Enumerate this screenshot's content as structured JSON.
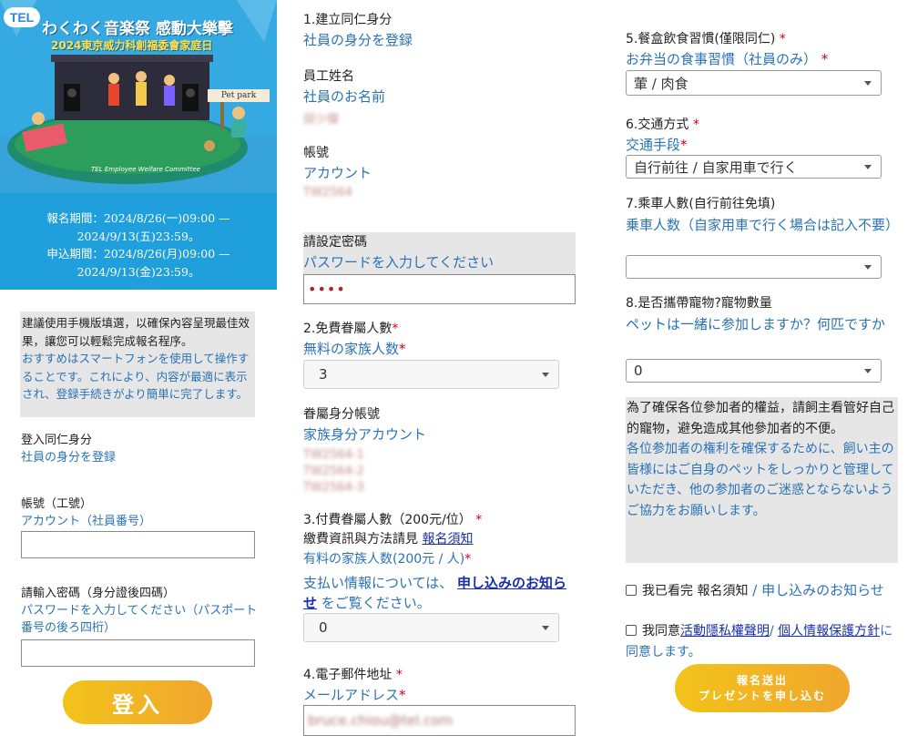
{
  "left": {
    "banner": {
      "logo": "TEL",
      "title_line1": "わくわく音楽祭 感動大樂擊",
      "title_line2": "2024東京威力科創福委會家庭日",
      "sign": "Pet park",
      "committee": "TEL Employee Welfare Committee"
    },
    "period": {
      "line1": "報名期間：2024/8/26(一)09:00 —",
      "line2": "2024/9/13(五)23:59。",
      "line3": "申込期間：2024/8/26(月)09:00 —",
      "line4": "2024/9/13(金)23:59。"
    },
    "notice": {
      "zh": "建議使用手機版填選，以確保內容呈現最佳效果，讓您可以輕鬆完成報名程序。",
      "jp": "おすすめはスマートフォンを使用して操作することです。これにより、内容が最適に表示され、登録手続きがより簡単に完了します。"
    },
    "login": {
      "heading_zh": "登入同仁身分",
      "heading_jp": "社員の身分を登録",
      "account_zh": "帳號（工號）",
      "account_jp": "アカウント（社員番号）",
      "password_zh": "請輸入密碼（身分證後四碼）",
      "password_jp": "パスワードを入力してください（パスポート番号の後ろ四桁）",
      "button": "登入"
    }
  },
  "mid": {
    "s1_zh": "1.建立同仁身分",
    "s1_jp": "社員の身分を登録",
    "name_zh": "員工姓名",
    "name_jp": "社員のお名前",
    "name_value": "邱少傑",
    "acct_zh": "帳號",
    "acct_jp": "アカウント",
    "acct_value": "TW2564",
    "pwd_zh": "請設定密碼",
    "pwd_jp": "パスワードを入力してください",
    "pwd_value": "••••",
    "s2_zh": "2.免費眷屬人數",
    "s2_jp": "無料の家族人数",
    "s2_value": "3",
    "fam_zh": "眷屬身分帳號",
    "fam_jp": "家族身分アカウント",
    "fam_values": [
      "TW2564-1",
      "TW2564-2",
      "TW2564-3"
    ],
    "s3_zh": "3.付費眷屬人數（200元/位）",
    "s3_note_zh": "繳費資訊與方法請見",
    "s3_note_link": "報名須知",
    "s3_jp": "有料の家族人数(200元 / 人)",
    "s3_note_jp_pre": "支払い情報については、",
    "s3_note_jp_link": "申し込みのお知らせ",
    "s3_note_jp_post": "をご覧ください。",
    "s3_value": "0",
    "s4_zh": "4.電子郵件地址",
    "s4_jp": "メールアドレス",
    "s4_value": "bruce.chiou@tel.com",
    "star": "*"
  },
  "right": {
    "s5_zh": "5.餐盒飲食習慣(僅限同仁)",
    "s5_jp": "お弁当の食事習慣（社員のみ）",
    "s5_value": "葷 / 肉食",
    "s6_zh": "6.交通方式",
    "s6_jp": "交通手段",
    "s6_value": "自行前往 / 自家用車で行く",
    "s7_zh": "7.乘車人數(自行前往免填)",
    "s7_jp": "乗車人数（自家用車で行く場合は記入不要）",
    "s7_value": "",
    "s8_zh": "8.是否攜帶寵物?寵物數量",
    "s8_jp": "ペットは一緒に参加しますか？何匹ですか",
    "s8_value": "0",
    "pet_notice_zh": "為了確保各位參加者的權益，請飼主看管好自己的寵物，避免造成其他參加者的不便。",
    "pet_notice_jp": "各位参加者の権利を確保するために、飼い主の皆様にはご自身のペットをしっかりと管理していただき、他の参加者のご迷惑とならないようご協力をお願いします。",
    "agree1_zh": "我已看完 報名須知",
    "agree1_sep": "/",
    "agree1_jp": "申し込みのお知らせ",
    "agree2_pre": "我同意",
    "agree2_link1": "活動隱私權聲明",
    "agree2_sep": "/",
    "agree2_link2": "個人情報保護方針",
    "agree2_post": "に同意します。",
    "submit_zh": "報名送出",
    "submit_jp": "プレゼントを申し込む"
  }
}
